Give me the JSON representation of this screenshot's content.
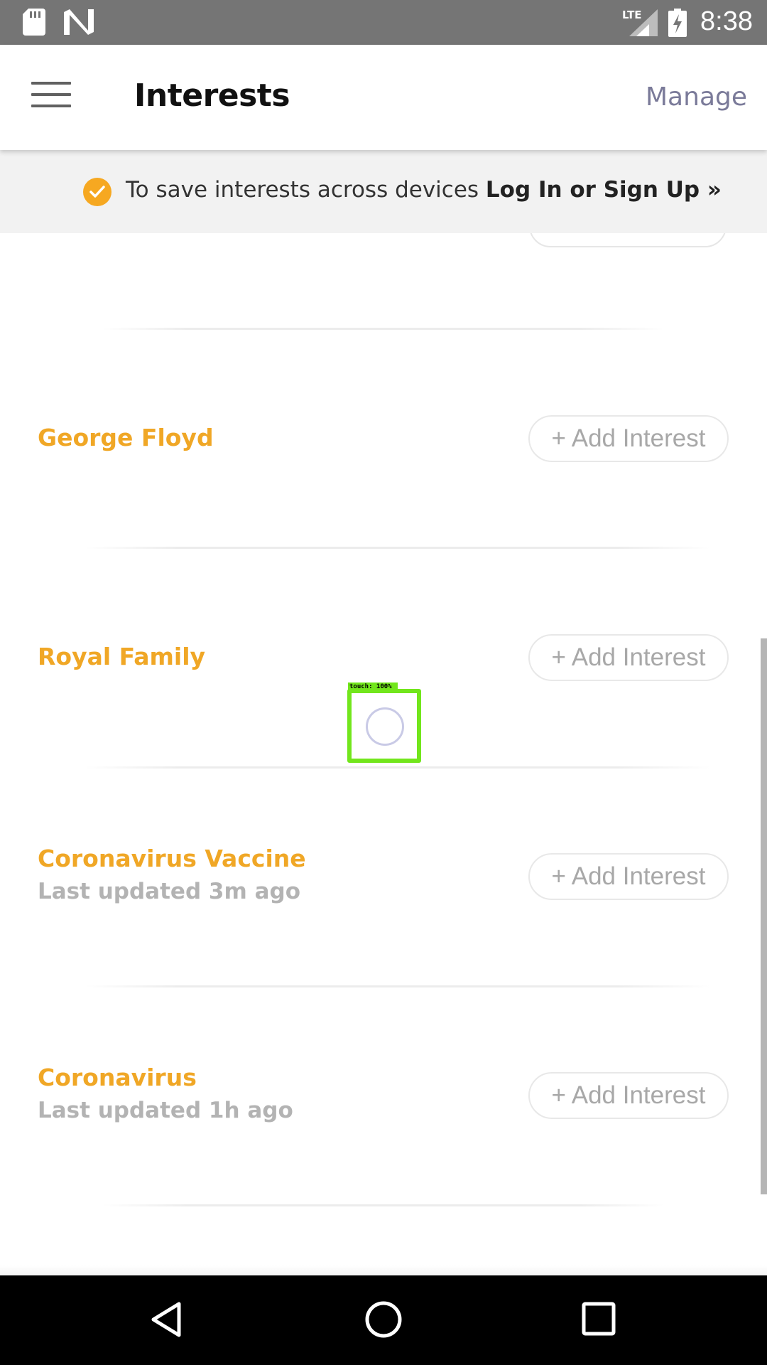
{
  "status_bar": {
    "time": "8:38",
    "network": "LTE",
    "icons": [
      "sd-card-icon",
      "n-notification-icon",
      "lte-signal-icon",
      "battery-charging-icon"
    ]
  },
  "toolbar": {
    "title": "Interests",
    "manage_label": "Manage",
    "menu_icon": "hamburger-menu-icon"
  },
  "banner": {
    "text": "To save interests across devices ",
    "link": "Log In or Sign Up »",
    "icon": "check-circle-icon",
    "accent_color": "#f6a821"
  },
  "interests": [
    {
      "title": "George Floyd",
      "subtitle": "",
      "button_label": "+ Add Interest"
    },
    {
      "title": "Royal Family",
      "subtitle": "",
      "button_label": "+ Add Interest"
    },
    {
      "title": "Coronavirus Vaccine",
      "subtitle": "Last updated 3m ago",
      "button_label": "+ Add Interest"
    },
    {
      "title": "Coronavirus",
      "subtitle": "Last updated 1h ago",
      "button_label": "+ Add Interest"
    }
  ],
  "touch_overlay": {
    "label": "touch: 100%"
  },
  "colors": {
    "interest_title": "#f0a726",
    "status_bar": "#757575",
    "nav_bar": "#000000"
  },
  "nav_bar": {
    "icons": [
      "back-icon",
      "home-icon",
      "recents-icon"
    ]
  }
}
